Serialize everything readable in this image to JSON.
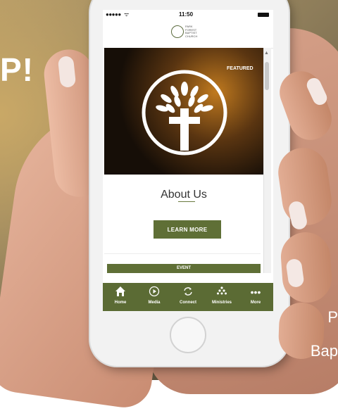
{
  "background": {
    "headline": "P!",
    "corner_line_1": "P",
    "corner_line_2": "Bap"
  },
  "status_bar": {
    "signal": "●●●●● ",
    "wifi": "ᯤ",
    "time": "11:50"
  },
  "header": {
    "logo_lines": [
      "PARK",
      "FOREST",
      "BAPTIST",
      "CHURCH"
    ]
  },
  "hero": {
    "badge": "FEATURED"
  },
  "content": {
    "title": "About Us",
    "button_label": "LEARN MORE",
    "event_label": "EVENT"
  },
  "tabbar": {
    "items": [
      {
        "label": "Home",
        "icon": "home-icon"
      },
      {
        "label": "Media",
        "icon": "play-icon"
      },
      {
        "label": "Connect",
        "icon": "connect-icon"
      },
      {
        "label": "Ministries",
        "icon": "people-icon"
      },
      {
        "label": "More",
        "icon": "more-icon"
      }
    ]
  },
  "colors": {
    "accent": "#5f6f36",
    "tabbar": "#5b6b34"
  }
}
